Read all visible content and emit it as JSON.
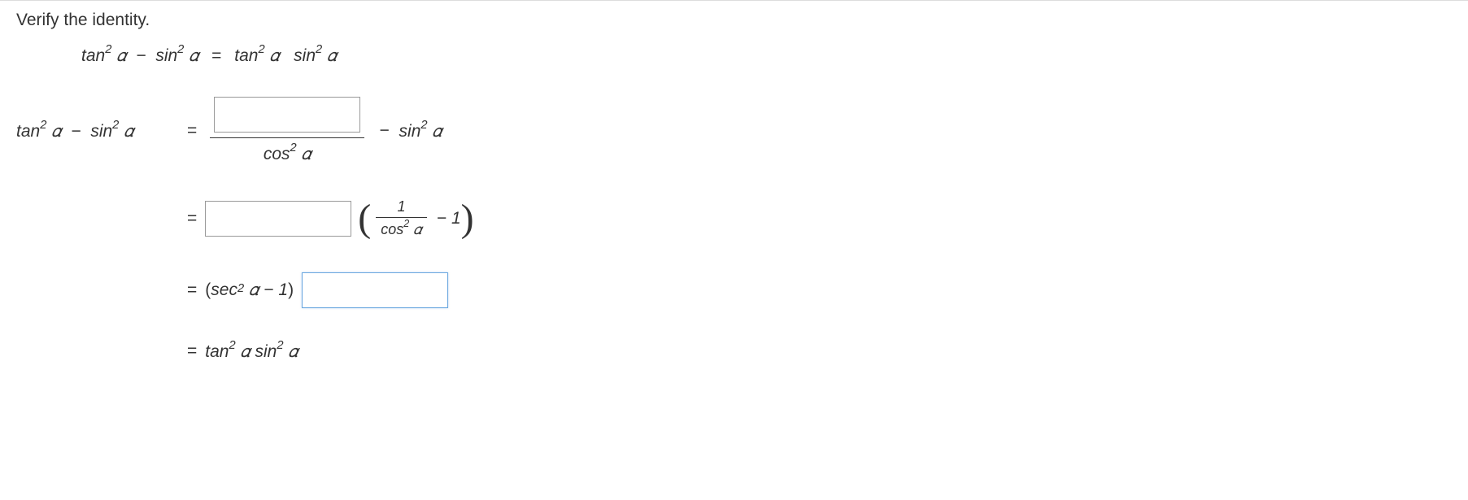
{
  "prompt": "Verify the identity.",
  "identity": {
    "lhs_tan2": "tan",
    "lhs_sin2": "sin",
    "rhs_tan2": "tan",
    "rhs_sin2": "sin",
    "alpha": "𝛼",
    "minus": "−",
    "equals": "="
  },
  "step1": {
    "lhs_tan": "tan",
    "lhs_sin": "sin",
    "alpha": "𝛼",
    "minus": "−",
    "eq": "=",
    "den_cos": "cos",
    "after_minus": "−",
    "after_sin": "sin"
  },
  "step2": {
    "eq": "=",
    "paren_frac_num": "1",
    "paren_frac_den_cos": "cos",
    "alpha": "𝛼",
    "minus": "−",
    "one": "1"
  },
  "step3": {
    "eq": "=",
    "sec": "sec",
    "alpha": "𝛼",
    "minus": "−",
    "one": "1"
  },
  "step4": {
    "eq": "=",
    "tan": "tan",
    "sin": "sin",
    "alpha": "𝛼"
  }
}
